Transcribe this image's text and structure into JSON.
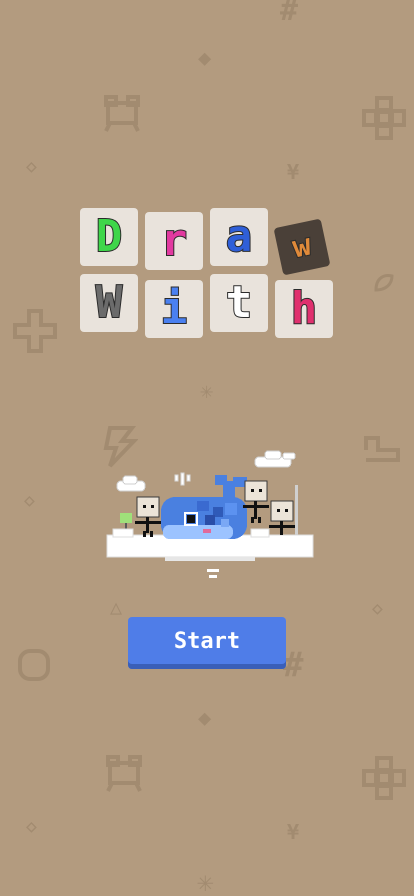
{
  "title": {
    "letters": [
      "D",
      "r",
      "a",
      "w",
      "W",
      "i",
      "t",
      "h"
    ],
    "colors": [
      "#3fd64a",
      "#e23aa0",
      "#2f5fd8",
      "#e08a3a",
      "#6b6b6b",
      "#4a80f0",
      "#ffffff",
      "#e0306e"
    ]
  },
  "background_icons": {
    "hash": "#",
    "diamond": "◆",
    "frog": "frog-icon",
    "flower": "flower-icon",
    "sparkle": "◇",
    "yen": "¥",
    "plus": "+",
    "asterisk": "✳",
    "lightning": "lightning-icon",
    "snake": "snake-icon",
    "triangle": "△",
    "circle": "○",
    "leaf": "leaf-icon"
  },
  "start_button": {
    "label": "Start"
  },
  "colors": {
    "background": "#b39b7f",
    "pattern": "#a28b70",
    "button": "#4f7de8",
    "whale": "#4a80e0"
  }
}
